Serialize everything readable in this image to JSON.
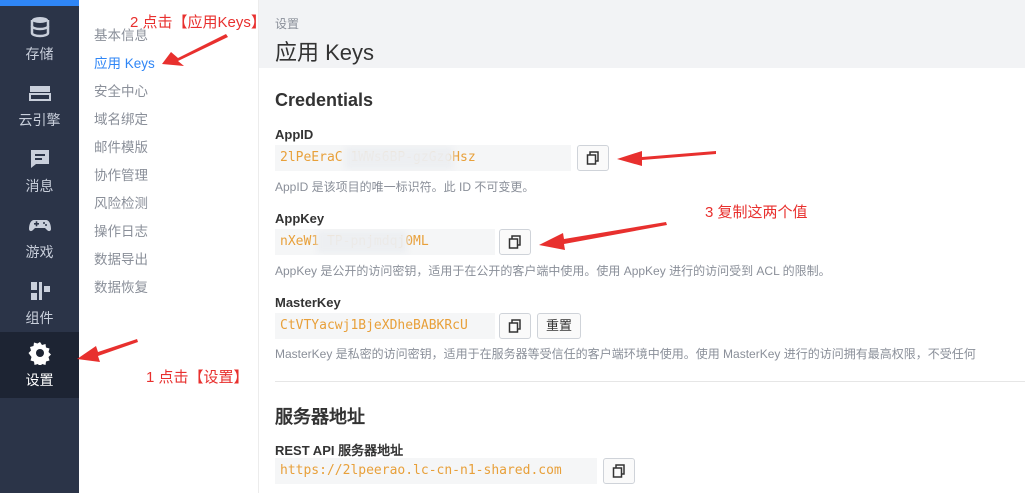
{
  "rail": {
    "items": [
      {
        "label": "存储",
        "icon": "database-icon"
      },
      {
        "label": "云引擎",
        "icon": "server-icon"
      },
      {
        "label": "消息",
        "icon": "message-icon"
      },
      {
        "label": "游戏",
        "icon": "gamepad-icon"
      },
      {
        "label": "组件",
        "icon": "components-icon"
      },
      {
        "label": "设置",
        "icon": "gear-icon",
        "active": true
      }
    ]
  },
  "submenu": {
    "items": [
      {
        "label": "基本信息"
      },
      {
        "label": "应用 Keys",
        "active": true
      },
      {
        "label": "安全中心"
      },
      {
        "label": "域名绑定"
      },
      {
        "label": "邮件模版"
      },
      {
        "label": "协作管理"
      },
      {
        "label": "风险检测"
      },
      {
        "label": "操作日志"
      },
      {
        "label": "数据导出"
      },
      {
        "label": "数据恢复"
      }
    ]
  },
  "header": {
    "breadcrumb": "设置",
    "title": "应用 Keys"
  },
  "credentials": {
    "title": "Credentials",
    "appid": {
      "label": "AppID",
      "value": "2lPeEraC              1WWs6BP-gzGzoHsz",
      "help": "AppID 是该项目的唯一标识符。此 ID 不可变更。"
    },
    "appkey": {
      "label": "AppKey",
      "value": "nXeW1         TP-pnjmdqj0ML",
      "help": "AppKey 是公开的访问密钥，适用于在公开的客户端中使用。使用 AppKey 进行的访问受到 ACL 的限制。"
    },
    "masterkey": {
      "label": "MasterKey",
      "value": "CtVTYacwj1BjeXDheBABKRcU",
      "reset_label": "重置",
      "help": "MasterKey 是私密的访问密钥，适用于在服务器等受信任的客户端环境中使用。使用 MasterKey 进行的访问拥有最高权限，不受任何"
    }
  },
  "server": {
    "title": "服务器地址",
    "rest": {
      "label": "REST API 服务器地址",
      "value": "https://2lpeerao.lc-cn-n1-shared.com"
    }
  },
  "annotations": {
    "step1": "1 点击【设置】",
    "step2": "2 点击【应用Keys】",
    "step3": "3 复制这两个值"
  },
  "colors": {
    "rail_bg": "#2b3448",
    "accent": "#2f86f6",
    "key_text": "#e8a03a",
    "annotation": "#e8302e"
  }
}
